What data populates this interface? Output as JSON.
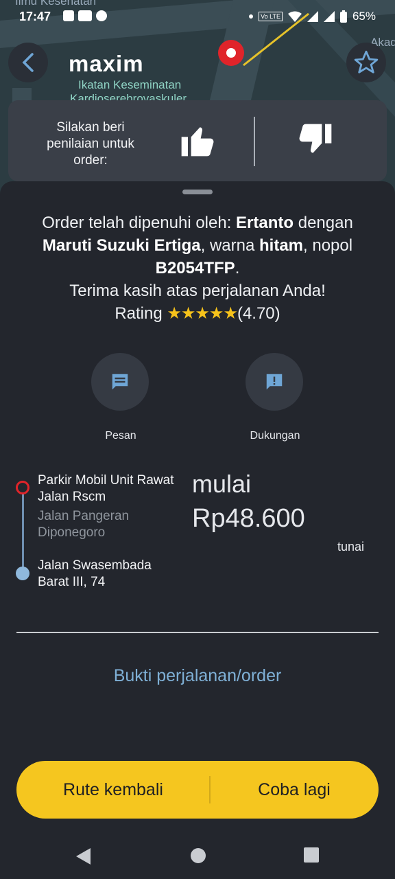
{
  "status_bar": {
    "time": "17:47",
    "battery": "65%",
    "icons": [
      "facebook-icon",
      "youtube-icon",
      "chrome-icon",
      "volte-icon",
      "wifi-icon",
      "signal-icon",
      "battery-icon"
    ]
  },
  "map": {
    "labels": {
      "top": "Ilmu Kesehatan",
      "poi": "Ikatan Keseminatan",
      "poi_line2": "Kardioserebrovaskuler",
      "right": "Akad"
    }
  },
  "header": {
    "logo": "maxim"
  },
  "rating_prompt": {
    "text": "Silakan beri penilaian untuk order:"
  },
  "summary": {
    "prefix": "Order telah dipenuhi oleh:",
    "driver": "Ertanto",
    "dengan": "dengan",
    "car": "Maruti Suzuki Ertiga",
    "warna": ", warna",
    "color": "hitam",
    "nopol": ", nopol",
    "plate": "B2054TFP",
    "thanks": "Terima kasih atas perjalanan Anda!",
    "rating_label": "Rating",
    "stars": "★★★★★",
    "rating_value": "(4.70)"
  },
  "actions": {
    "message_label": "Pesan",
    "support_label": "Dukungan"
  },
  "route": {
    "from": "Parkir Mobil Unit Rawat Jalan Rscm",
    "from_street": "Jalan Pangeran Diponegoro",
    "to": "Jalan Swasembada Barat III, 74"
  },
  "price": {
    "prefix": "mulai",
    "amount": "Rp48.600",
    "payment": "tunai"
  },
  "proof_link": "Bukti perjalanan/order",
  "bottom_bar": {
    "return_route": "Rute kembali",
    "try_again": "Coba lagi"
  },
  "colors": {
    "accent": "#f5c61f",
    "background": "#23262d",
    "link": "#7fb0d6",
    "star": "#f6c21b"
  }
}
